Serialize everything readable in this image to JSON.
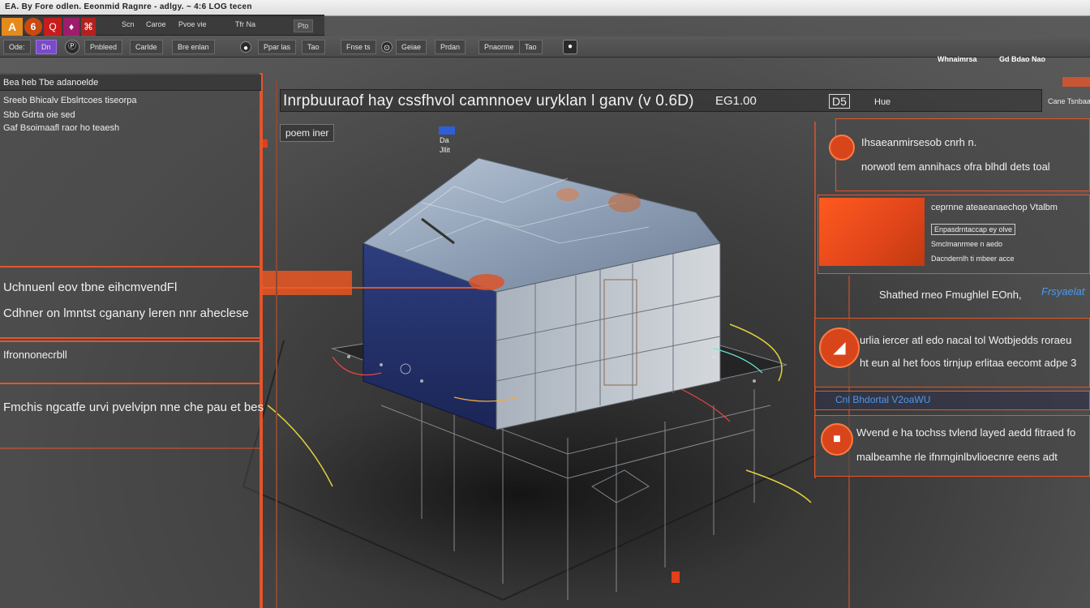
{
  "window": {
    "title": "EA. By Fore odlen. Eeonmid Ragnre -  adlgy.  ~ 4:6 LOG  tecen"
  },
  "toolbar1": {
    "logos": [
      "A",
      "6",
      "Q",
      "♦",
      "⌘"
    ],
    "items": [
      "Scn",
      "Caroe",
      "Pvoe vie",
      "Tfr Na"
    ],
    "right_btn": "Pto"
  },
  "toolbar2": {
    "buttons": [
      "Ode:",
      "Dn",
      "Pnbleed",
      "Carlde",
      "Bre enlan",
      "Ppar las",
      "Tao",
      "Fnse ts",
      "Geiae",
      "Prdan",
      "Pnaorme"
    ],
    "icons": [
      "Ⓟ",
      "●",
      "⊙",
      "●"
    ]
  },
  "top_right": {
    "label_left": "Whnaimrsa",
    "label_right": "Gd Bdao Nao"
  },
  "left_panel": {
    "header": "Bea heb Tbe adanoelde",
    "lines": [
      "Sreeb Bhicalv Ebslrtcoes tiseorpa",
      "Sbb Gdrta oie sed",
      "Gaf Bsoimaafl raor ho teaesh"
    ],
    "box1_line1": "Uchnuenl eov tbne eihcmvendFl",
    "box1_line2": "Cdhner on lmntst cganany leren nnr aheclese",
    "box2": "Ifronnonecrbll",
    "box3": "Fmchis  ngcatfe urvi pvelvipn  nne  che  pau  et  bes"
  },
  "viewport": {
    "header": "Inrpbuuraof hay cssfhvol camnnoev uryklan   l  ganv  (v 0.6D)",
    "header_right": "EG1.00",
    "tag": "D5",
    "tag2": "Hue",
    "chip": "poem iner",
    "side_labels": [
      "Da",
      "Jllit"
    ],
    "corner": "Cane Tsnbaasde"
  },
  "right_panels": {
    "p1_title": "Ihsaeanmirsesob cnrh n.",
    "p1_sub": "norwotl tem annihacs  ofra  blhdl dets  toal",
    "p2_title": "ceprnne ateaeanaechop  Vtalbm",
    "p2_field1": "Enpasdrntaccap ey olve",
    "p2_field2": "Smclmanrmee n aedo",
    "p2_field3": "Dacndernlh ti  mbeer acce",
    "p3_title": "Shathed rneo Fmughlel EOnh,",
    "p3_blue": "Frsyaelat",
    "p4_line1": "urlia iercer atl  edo nacal  tol Wotbjedds roraeu",
    "p4_line2": "ht eun al het foos tirnjup erlitaa  eecomt  adpe  3",
    "p5_head": "Cnl Bhdortal V2oaWU",
    "p6_line1": "Wvend e ha tochss tvlend layed aedd fitraed fo",
    "p6_line2": "malbeamhe rle ifnrnginlbvlioecnre eens  adt"
  },
  "colors": {
    "accent": "#e5552a",
    "blue": "#2e5fd6",
    "panel": "#484848"
  }
}
